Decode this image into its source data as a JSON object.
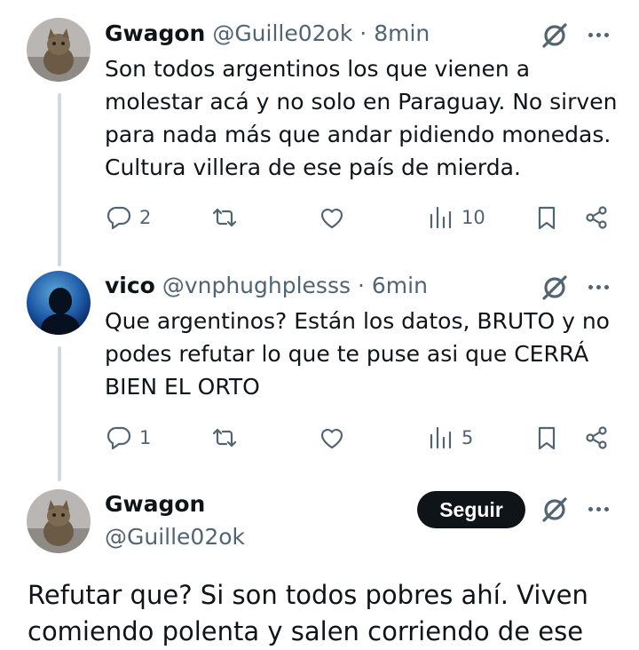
{
  "tweets": [
    {
      "name": "Gwagon",
      "handle": "@Guille02ok",
      "separator": "·",
      "time": "8min",
      "avatar_icon": "cat-avatar",
      "lines": [
        "Son todos argentinos los que vienen a",
        "molestar acá y no solo en Paraguay. No sirven",
        "para nada más que andar pidiendo monedas.",
        "Cultura villera de ese país de mierda."
      ],
      "replies": "2",
      "views": "10"
    },
    {
      "name": "vico",
      "handle": "@vnphughplesss",
      "separator": "·",
      "time": "6min",
      "avatar_icon": "dark-silhouette-avatar",
      "lines": [
        "Que argentinos? Están los datos, BRUTO y no",
        "podes refutar lo que te puse asi que CERRÁ",
        "BIEN EL ORTO"
      ],
      "replies": "1",
      "views": "5"
    }
  ],
  "main_tweet": {
    "name": "Gwagon",
    "handle": "@Guille02ok",
    "follow_label": "Seguir",
    "avatar_icon": "cat-avatar",
    "lines": [
      "Refutar que? Si son todos pobres ahí. Viven",
      "comiendo polenta y salen corriendo de ese"
    ]
  },
  "colors": {
    "text": "#0f1419",
    "muted": "#536471",
    "thread_line": "#cfd9de",
    "button_bg": "#0f1419",
    "button_text": "#ffffff"
  },
  "icons": [
    "reply-icon",
    "retweet-icon",
    "like-icon",
    "views-icon",
    "bookmark-icon",
    "share-icon",
    "grok-icon",
    "more-icon"
  ]
}
